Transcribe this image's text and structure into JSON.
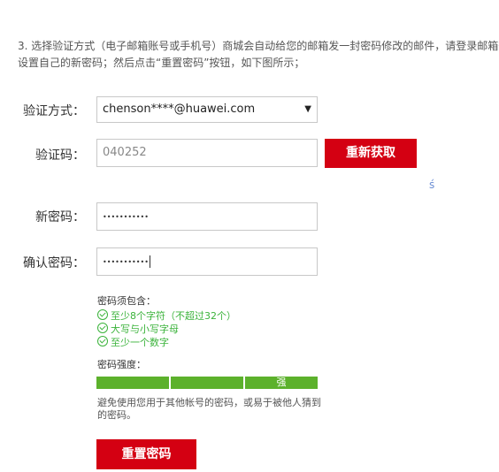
{
  "intro": {
    "line1": "3. 选择验证方式（电子邮箱账号或手机号）商城会自动给您的邮箱发一封密码修改的邮件，请登录邮箱查",
    "line2": "设置自己的新密码；然后点击“重置密码”按钮，如下图所示；"
  },
  "form": {
    "method_label": "验证方式：",
    "method_value": "chenson****@huawei.com",
    "code_label": "验证码：",
    "code_value": "040252",
    "refresh_button": "重新获取",
    "new_password_label": "新密码：",
    "new_password_value": "•••••••••••",
    "confirm_password_label": "确认密码：",
    "confirm_password_value": "•••••••••••"
  },
  "side_mark": "ś",
  "requirements": {
    "title": "密码须包含：",
    "items": [
      "至少8个字符（不超过32个）",
      "大写与小写字母",
      "至少一个数字"
    ]
  },
  "strength": {
    "title": "密码强度：",
    "level_label": "强",
    "level_fraction": 1.0,
    "color": "#5cb12c"
  },
  "advice": "避免使用您用于其他帐号的密码，或易于被他人猜到的密码。",
  "reset_button": "重置密码",
  "colors": {
    "accent": "#d40012",
    "ok": "#3bb33b"
  },
  "icons": {
    "check": "check-circle-icon",
    "dropdown": "triangle-down-icon"
  }
}
